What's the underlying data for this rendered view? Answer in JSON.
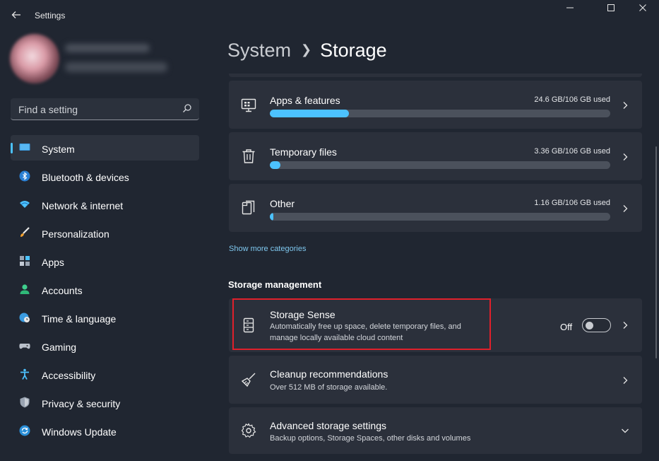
{
  "window": {
    "app_title": "Settings"
  },
  "search": {
    "placeholder": "Find a setting"
  },
  "nav": {
    "items": [
      {
        "label": "System",
        "icon": "monitor-icon",
        "active": true
      },
      {
        "label": "Bluetooth & devices",
        "icon": "bluetooth-icon"
      },
      {
        "label": "Network & internet",
        "icon": "wifi-icon"
      },
      {
        "label": "Personalization",
        "icon": "brush-icon"
      },
      {
        "label": "Apps",
        "icon": "apps-icon"
      },
      {
        "label": "Accounts",
        "icon": "person-icon"
      },
      {
        "label": "Time & language",
        "icon": "globe-clock-icon"
      },
      {
        "label": "Gaming",
        "icon": "gamepad-icon"
      },
      {
        "label": "Accessibility",
        "icon": "accessibility-icon"
      },
      {
        "label": "Privacy & security",
        "icon": "shield-icon"
      },
      {
        "label": "Windows Update",
        "icon": "refresh-icon"
      }
    ]
  },
  "header": {
    "parent": "System",
    "current": "Storage"
  },
  "categories": [
    {
      "title": "Apps & features",
      "used": "24.6 GB/106 GB used",
      "fraction": 0.232,
      "icon": "apps-features-icon"
    },
    {
      "title": "Temporary files",
      "used": "3.36 GB/106 GB used",
      "fraction": 0.032,
      "icon": "trash-icon"
    },
    {
      "title": "Other",
      "used": "1.16 GB/106 GB used",
      "fraction": 0.011,
      "icon": "documents-icon"
    }
  ],
  "show_more": "Show more categories",
  "storage_management": {
    "title": "Storage management",
    "storage_sense": {
      "title": "Storage Sense",
      "desc_line1": "Automatically free up space, delete temporary files, and",
      "desc_line2": "manage locally available cloud content",
      "toggle_label": "Off",
      "toggle_on": false
    },
    "cleanup": {
      "title": "Cleanup recommendations",
      "desc": "Over 512 MB of storage available."
    },
    "advanced": {
      "title": "Advanced storage settings",
      "desc": "Backup options, Storage Spaces, other disks and volumes"
    }
  },
  "colors": {
    "accent": "#4cc2ff",
    "background": "#202631",
    "card": "#2b303b",
    "highlight": "#e0202b"
  }
}
